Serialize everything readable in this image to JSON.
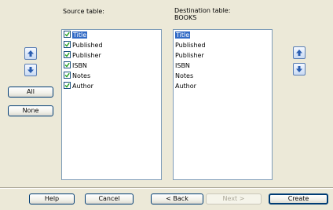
{
  "source": {
    "label": "Source table:",
    "items": [
      {
        "label": "Title",
        "checked": true,
        "selected": true
      },
      {
        "label": "Published",
        "checked": true,
        "selected": false
      },
      {
        "label": "Publisher",
        "checked": true,
        "selected": false
      },
      {
        "label": "ISBN",
        "checked": true,
        "selected": false
      },
      {
        "label": "Notes",
        "checked": true,
        "selected": false
      },
      {
        "label": "Author",
        "checked": true,
        "selected": false
      }
    ]
  },
  "destination": {
    "label": "Destination table:",
    "table_name": "BOOKS",
    "items": [
      {
        "label": "Title",
        "selected": true
      },
      {
        "label": "Published",
        "selected": false
      },
      {
        "label": "Publisher",
        "selected": false
      },
      {
        "label": "ISBN",
        "selected": false
      },
      {
        "label": "Notes",
        "selected": false
      },
      {
        "label": "Author",
        "selected": false
      }
    ]
  },
  "left_buttons": {
    "all": "All",
    "none": "None"
  },
  "footer": {
    "help": "Help",
    "cancel": "Cancel",
    "back": "< Back",
    "next": "Next >",
    "create": "Create"
  },
  "colors": {
    "dialog_bg": "#ece9d8",
    "selection": "#316ac5",
    "button_border": "#003c74",
    "arrow_blue": "#2a5db0"
  }
}
